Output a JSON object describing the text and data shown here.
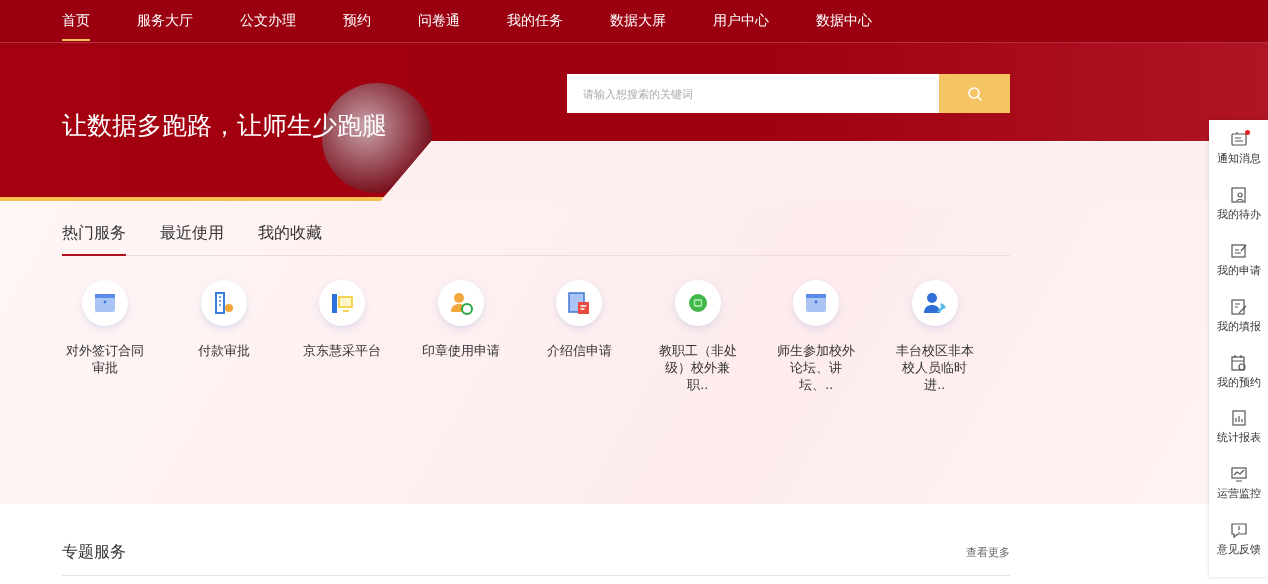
{
  "nav": [
    {
      "label": "首页",
      "selected": true
    },
    {
      "label": "服务大厅",
      "selected": false
    },
    {
      "label": "公文办理",
      "selected": false
    },
    {
      "label": "预约",
      "selected": false
    },
    {
      "label": "问卷通",
      "selected": false
    },
    {
      "label": "我的任务",
      "selected": false
    },
    {
      "label": "数据大屏",
      "selected": false
    },
    {
      "label": "用户中心",
      "selected": false
    },
    {
      "label": "数据中心",
      "selected": false
    }
  ],
  "banner": {
    "slogan": "让数据多跑路，让师生少跑腿",
    "search": {
      "placeholder": "请输入想搜索的关键词"
    }
  },
  "tabs": [
    {
      "label": "热门服务",
      "selected": true
    },
    {
      "label": "最近使用",
      "selected": false
    },
    {
      "label": "我的收藏",
      "selected": false
    }
  ],
  "services": [
    {
      "kind": "folder",
      "label": "对外签订合同审批"
    },
    {
      "kind": "building",
      "label": "付款审批"
    },
    {
      "kind": "monitor",
      "label": "京东慧采平台"
    },
    {
      "kind": "person-add",
      "label": "印章使用申请"
    },
    {
      "kind": "letter",
      "label": "介绍信申请"
    },
    {
      "kind": "disc",
      "label": "教职工（非处级）校外兼职.."
    },
    {
      "kind": "folder",
      "label": "师生参加校外论坛、讲坛、.."
    },
    {
      "kind": "person-tool",
      "label": "丰台校区非本校人员临时进.."
    }
  ],
  "special": {
    "title": "专题服务",
    "more": "查看更多"
  },
  "side": [
    {
      "kind": "notice",
      "label": "通知消息",
      "unread": true
    },
    {
      "kind": "todo",
      "label": "我的待办",
      "unread": false
    },
    {
      "kind": "apply",
      "label": "我的申请",
      "unread": false
    },
    {
      "kind": "fill",
      "label": "我的填报",
      "unread": false
    },
    {
      "kind": "calendar",
      "label": "我的预约",
      "unread": false
    },
    {
      "kind": "report",
      "label": "统计报表",
      "unread": false
    },
    {
      "kind": "monitor",
      "label": "运营监控",
      "unread": false
    },
    {
      "kind": "feedback",
      "label": "意见反馈",
      "unread": false
    }
  ]
}
